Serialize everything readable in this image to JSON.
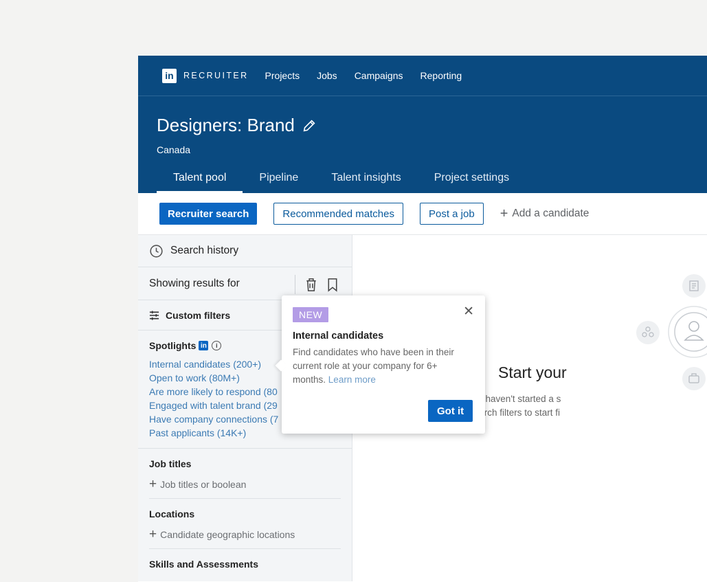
{
  "nav": {
    "logo": "in",
    "brand": "RECRUITER",
    "links": [
      "Projects",
      "Jobs",
      "Campaigns",
      "Reporting"
    ]
  },
  "header": {
    "title": "Designers: Brand",
    "subtitle": "Canada",
    "tabs": [
      "Talent pool",
      "Pipeline",
      "Talent insights",
      "Project settings"
    ],
    "active_tab": "Talent pool"
  },
  "actions": {
    "recruiter_search": "Recruiter search",
    "recommended_matches": "Recommended matches",
    "post_job": "Post a job",
    "add_candidate": "Add a candidate"
  },
  "sidebar": {
    "search_history": "Search history",
    "showing_results": "Showing results for",
    "custom_filters": "Custom filters",
    "spotlights": {
      "title": "Spotlights",
      "items": [
        "Internal candidates (200+)",
        "Open to work (80M+)",
        "Are more likely to respond (80",
        "Engaged with talent brand (29",
        "Have company connections (7",
        "Past applicants (14K+)"
      ]
    },
    "filters": [
      {
        "title": "Job titles",
        "placeholder": "Job titles or boolean"
      },
      {
        "title": "Locations",
        "placeholder": "Candidate geographic locations"
      },
      {
        "title": "Skills and Assessments",
        "placeholder": ""
      }
    ]
  },
  "main": {
    "empty_title": "Start your",
    "empty_sub_1": "You haven't started a s",
    "empty_sub_2": "search filters to start fi"
  },
  "popover": {
    "badge": "NEW",
    "title": "Internal candidates",
    "body": "Find candidates who have been in their current role at your company for 6+ months.",
    "learn_more": "Learn more",
    "button": "Got it"
  },
  "colors": {
    "header_bg": "#0a4a80",
    "primary": "#0a66c2",
    "badge": "#b39ce6"
  }
}
